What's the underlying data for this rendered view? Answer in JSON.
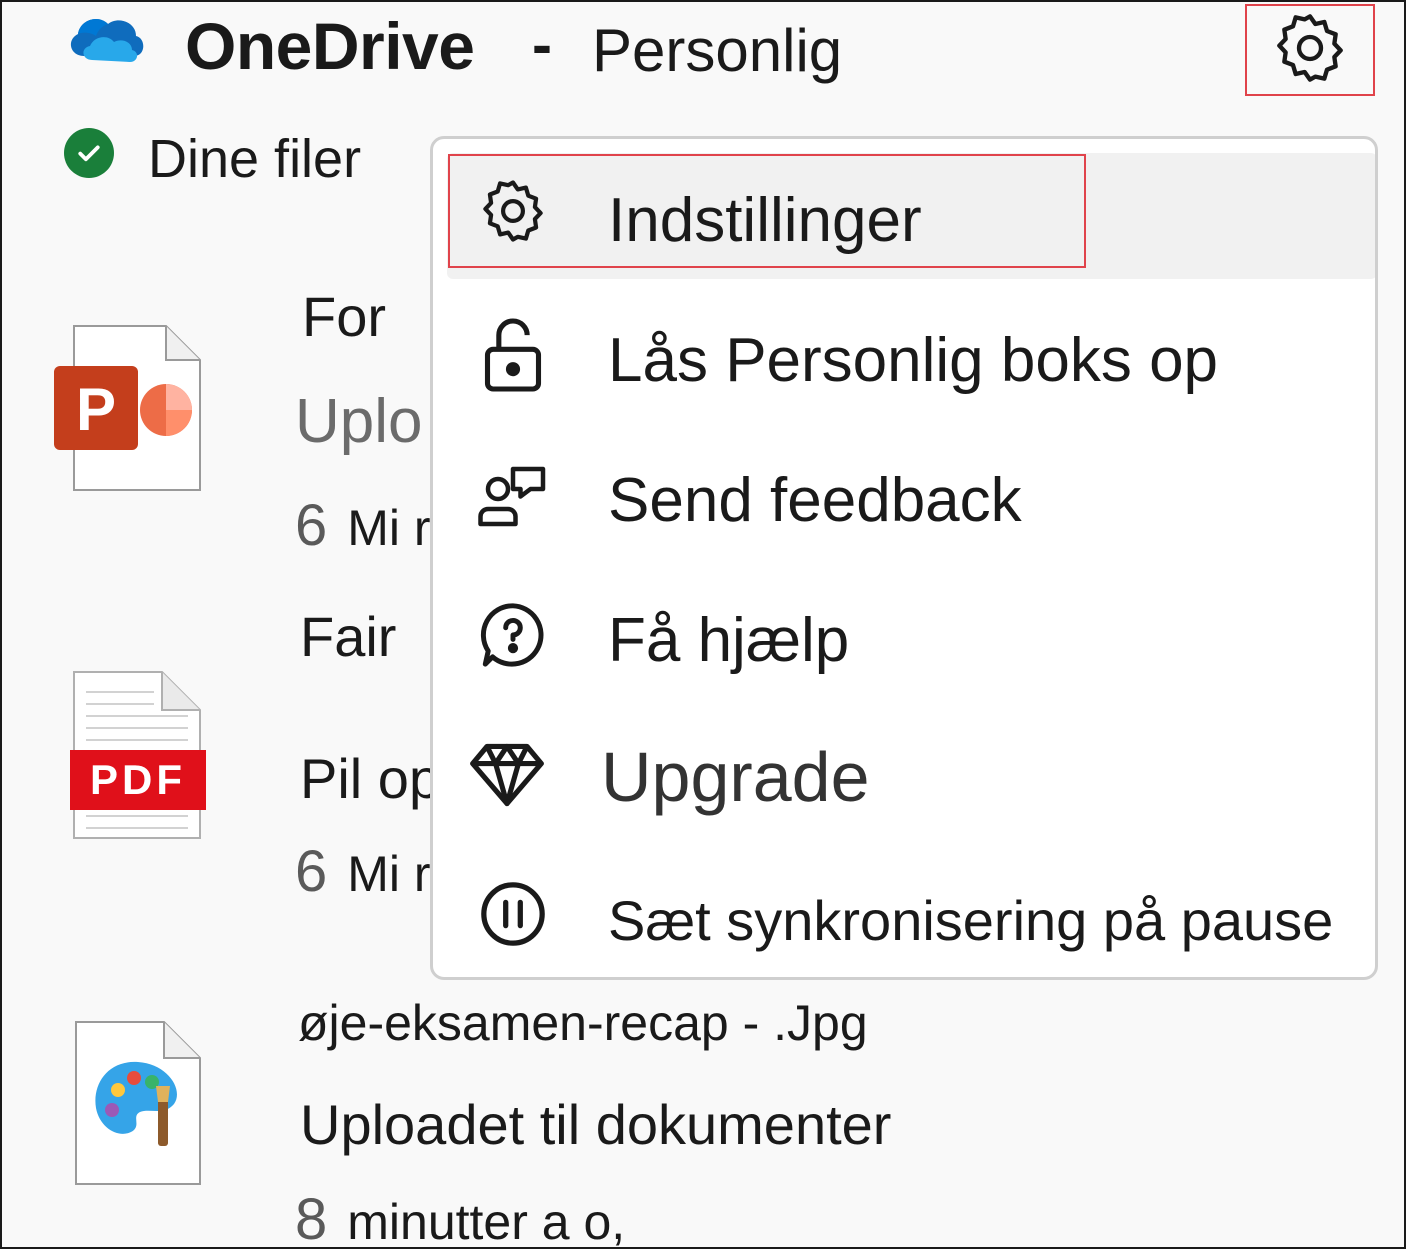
{
  "header": {
    "app_name": "OneDrive",
    "separator": "-",
    "account_type": "Personlig",
    "settings_icon": "gear-icon"
  },
  "status": {
    "text": "Dine filer",
    "icon": "check-circle-icon",
    "color": "#1a7f3a"
  },
  "files": [
    {
      "name": "For",
      "subtitle": "Uplo",
      "time_num": "6",
      "time_unit": "Mi r",
      "icon": "powerpoint-file-icon"
    },
    {
      "name": "Fair",
      "subtitle": "Pil op",
      "time_num": "6",
      "time_unit": "Mi r",
      "icon": "pdf-file-icon",
      "badge": "PDF"
    },
    {
      "name": "øje-eksamen-recap - .Jpg",
      "subtitle": "Uploadet til dokumenter",
      "time_num": "8",
      "time_unit": "minutter a o,",
      "icon": "image-file-icon"
    }
  ],
  "menu": {
    "items": [
      {
        "label": "Indstillinger",
        "icon": "gear-icon"
      },
      {
        "label": "Lås Personlig boks op",
        "icon": "unlock-icon"
      },
      {
        "label": "Send feedback",
        "icon": "feedback-icon"
      },
      {
        "label": "Få hjælp",
        "icon": "help-icon"
      },
      {
        "label": "Upgrade",
        "icon": "diamond-icon"
      },
      {
        "label": "Sæt synkronisering på pause",
        "icon": "pause-icon"
      }
    ]
  },
  "colors": {
    "highlight_border": "#e0434b",
    "accent_blue": "#0f6cbd",
    "pdf_red": "#e0101a",
    "ppt_orange": "#c43e1c"
  }
}
